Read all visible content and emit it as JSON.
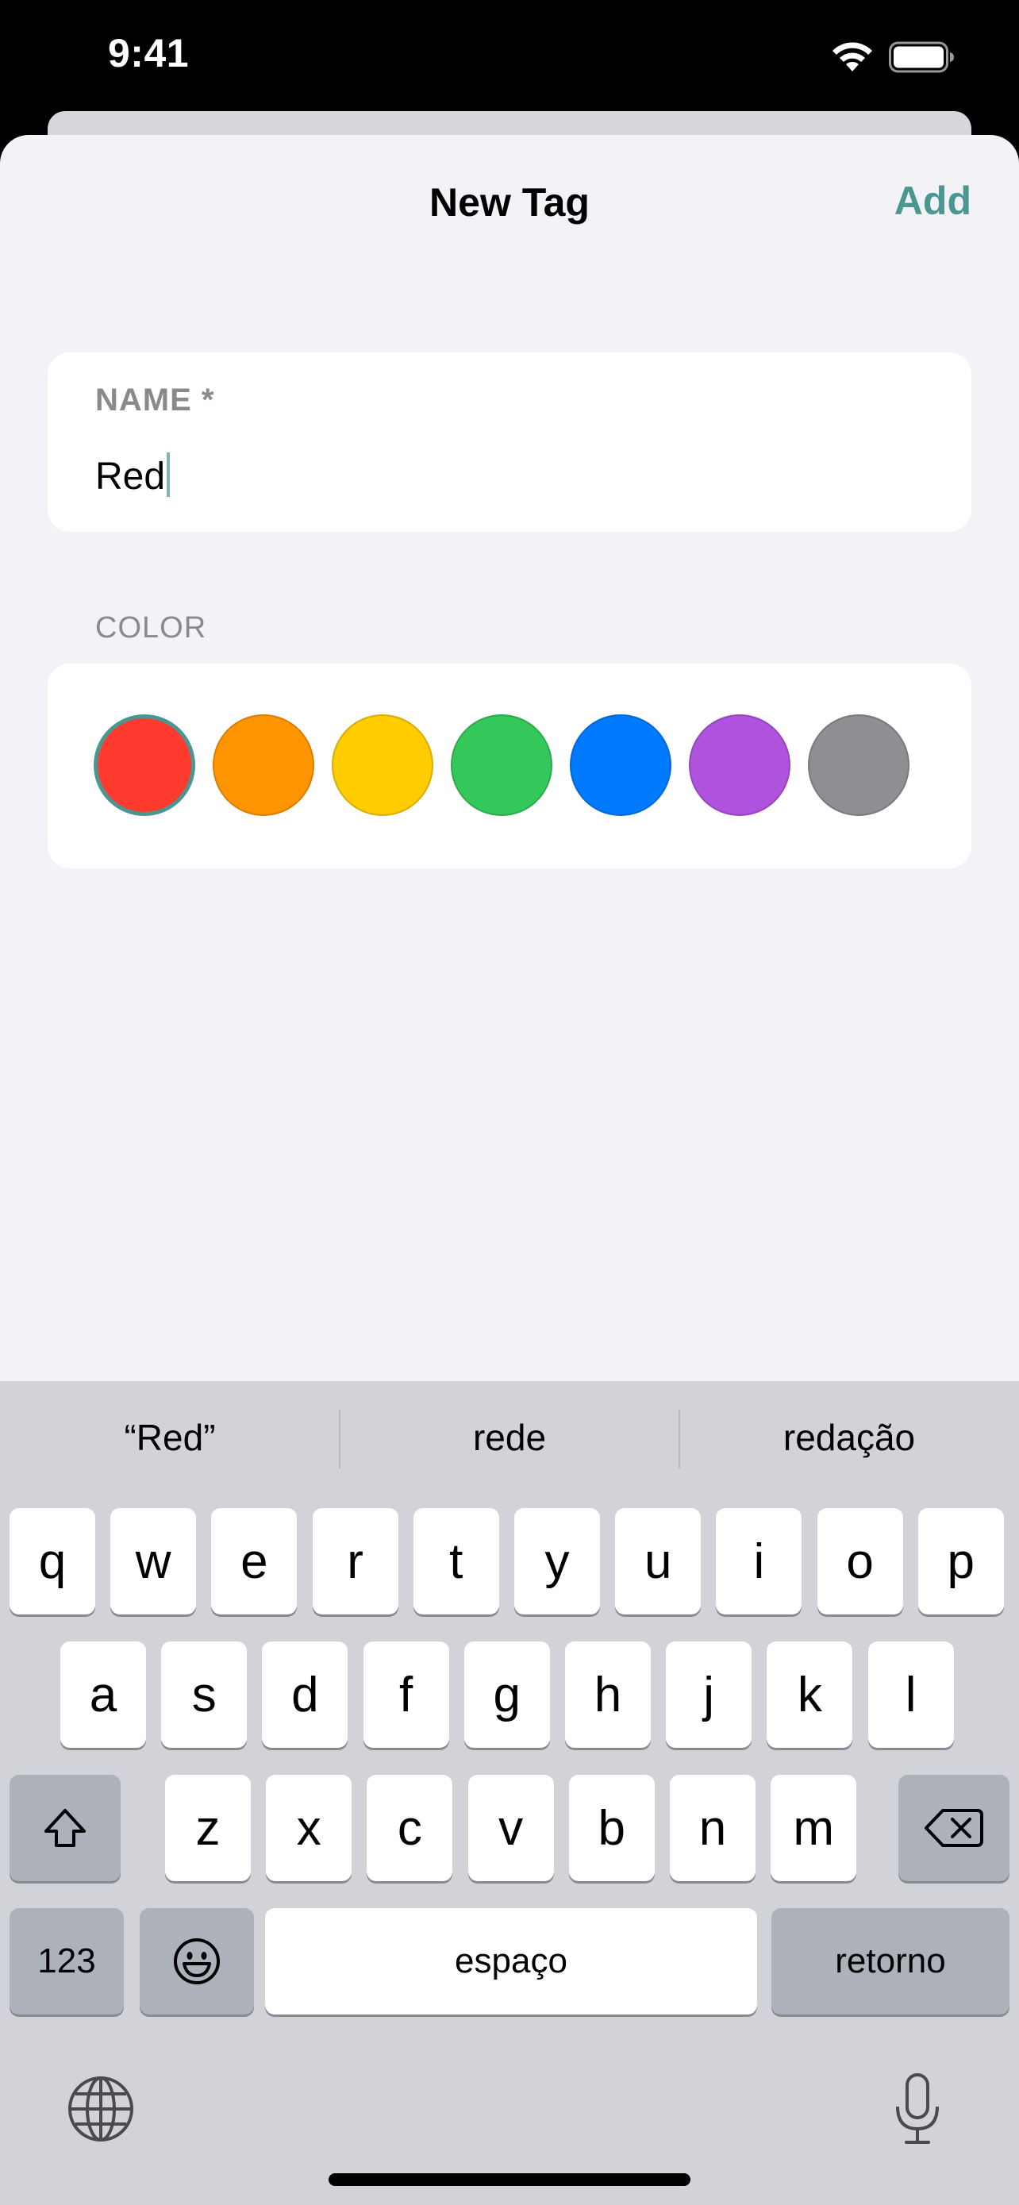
{
  "status_bar": {
    "time": "9:41",
    "icons": [
      "wifi-icon",
      "battery-icon"
    ]
  },
  "nav": {
    "title": "New Tag",
    "action": "Add"
  },
  "form": {
    "name_label": "NAME *",
    "name_value": "Red",
    "color_label": "COLOR",
    "colors": [
      {
        "name": "red",
        "hex": "#ff3b30",
        "selected": true
      },
      {
        "name": "orange",
        "hex": "#ff9500",
        "selected": false
      },
      {
        "name": "yellow",
        "hex": "#ffcc00",
        "selected": false
      },
      {
        "name": "green",
        "hex": "#34c759",
        "selected": false
      },
      {
        "name": "blue",
        "hex": "#007aff",
        "selected": false
      },
      {
        "name": "purple",
        "hex": "#af52de",
        "selected": false
      },
      {
        "name": "gray",
        "hex": "#8e8e93",
        "selected": false
      }
    ],
    "accent": "#4a9690"
  },
  "keyboard": {
    "suggestions": [
      "“Red”",
      "rede",
      "redação"
    ],
    "row1": [
      "q",
      "w",
      "e",
      "r",
      "t",
      "y",
      "u",
      "i",
      "o",
      "p"
    ],
    "row2": [
      "a",
      "s",
      "d",
      "f",
      "g",
      "h",
      "j",
      "k",
      "l"
    ],
    "row3": [
      "z",
      "x",
      "c",
      "v",
      "b",
      "n",
      "m"
    ],
    "numbers_key": "123",
    "space_key": "espaço",
    "return_key": "retorno",
    "icons": [
      "shift-icon",
      "delete-icon",
      "emoji-icon",
      "globe-icon",
      "mic-icon"
    ]
  }
}
